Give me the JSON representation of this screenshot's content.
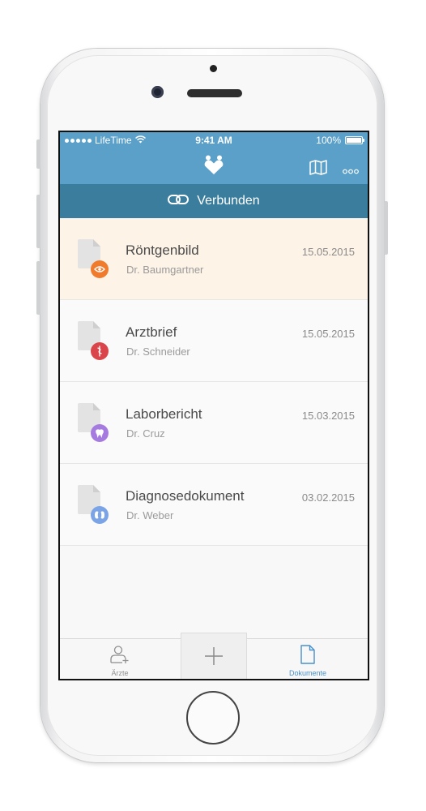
{
  "status_bar": {
    "carrier": "LifeTime",
    "time": "9:41 AM",
    "battery": "100%"
  },
  "nav_bar": {
    "logo_icon": "hearts-logo-icon",
    "map_icon": "map-icon",
    "more_icon": "more-dots-icon"
  },
  "connection": {
    "label": "Verbunden",
    "icon": "link-icon"
  },
  "documents": [
    {
      "title": "Röntgenbild",
      "doctor": "Dr. Baumgartner",
      "date": "15.05.2015",
      "badge_icon": "eye-icon",
      "badge_color": "#f07b2c",
      "selected": true
    },
    {
      "title": "Arztbrief",
      "doctor": "Dr. Schneider",
      "date": "15.05.2015",
      "badge_icon": "caduceus-icon",
      "badge_color": "#d9454a",
      "selected": false
    },
    {
      "title": "Laborbericht",
      "doctor": "Dr. Cruz",
      "date": "15.03.2015",
      "badge_icon": "tooth-icon",
      "badge_color": "#a67be0",
      "selected": false
    },
    {
      "title": "Diagnosedokument",
      "doctor": "Dr. Weber",
      "date": "03.02.2015",
      "badge_icon": "kidneys-icon",
      "badge_color": "#7aa4e6",
      "selected": false
    }
  ],
  "tab_bar": {
    "aerzte_label": "Ärzte",
    "dokumente_label": "Dokumente",
    "active_tab": "Dokumente"
  },
  "colors": {
    "nav_blue": "#5aa0c9",
    "connection_blue": "#3a7d9d",
    "selected_row": "#fdf3e6",
    "active_tab": "#4a90c9"
  }
}
